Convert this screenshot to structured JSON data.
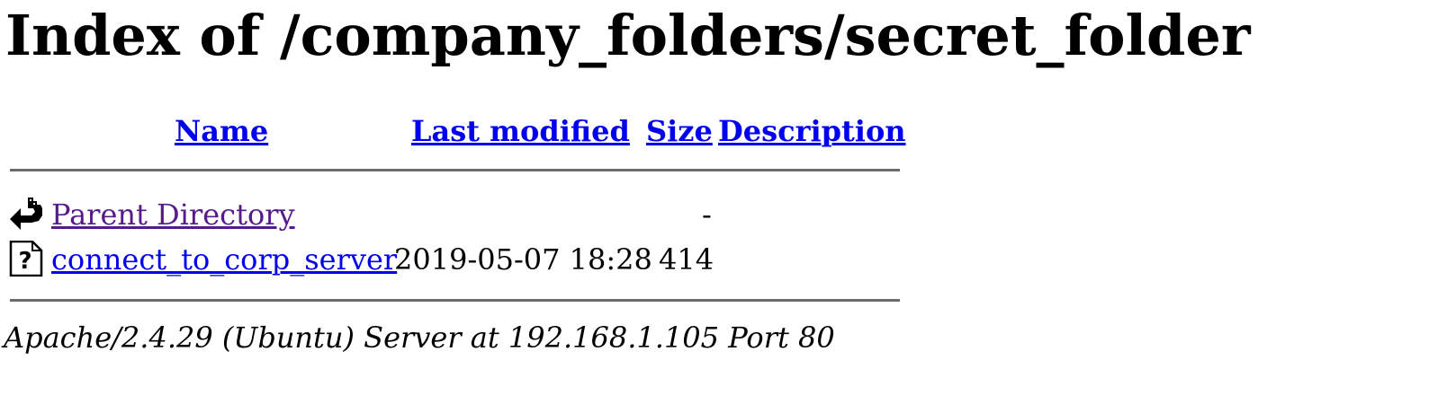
{
  "page": {
    "title": "Index of /company_folders/secret_folder"
  },
  "table": {
    "headers": {
      "name": "Name",
      "last_modified": "Last modified",
      "size": "Size",
      "description": "Description"
    },
    "rows": [
      {
        "icon": "back-arrow-icon",
        "name": "Parent Directory",
        "last_modified": "",
        "size": "-",
        "description": ""
      },
      {
        "icon": "unknown-file-icon",
        "name": "connect_to_corp_server",
        "last_modified": "2019-05-07 18:28",
        "size": "414",
        "description": ""
      }
    ]
  },
  "footer": {
    "server_signature": "Apache/2.4.29 (Ubuntu) Server at 192.168.1.105 Port 80"
  },
  "colors": {
    "link": "#0000ee",
    "visited_link": "#551a8b",
    "rule": "#6b6b6b"
  }
}
